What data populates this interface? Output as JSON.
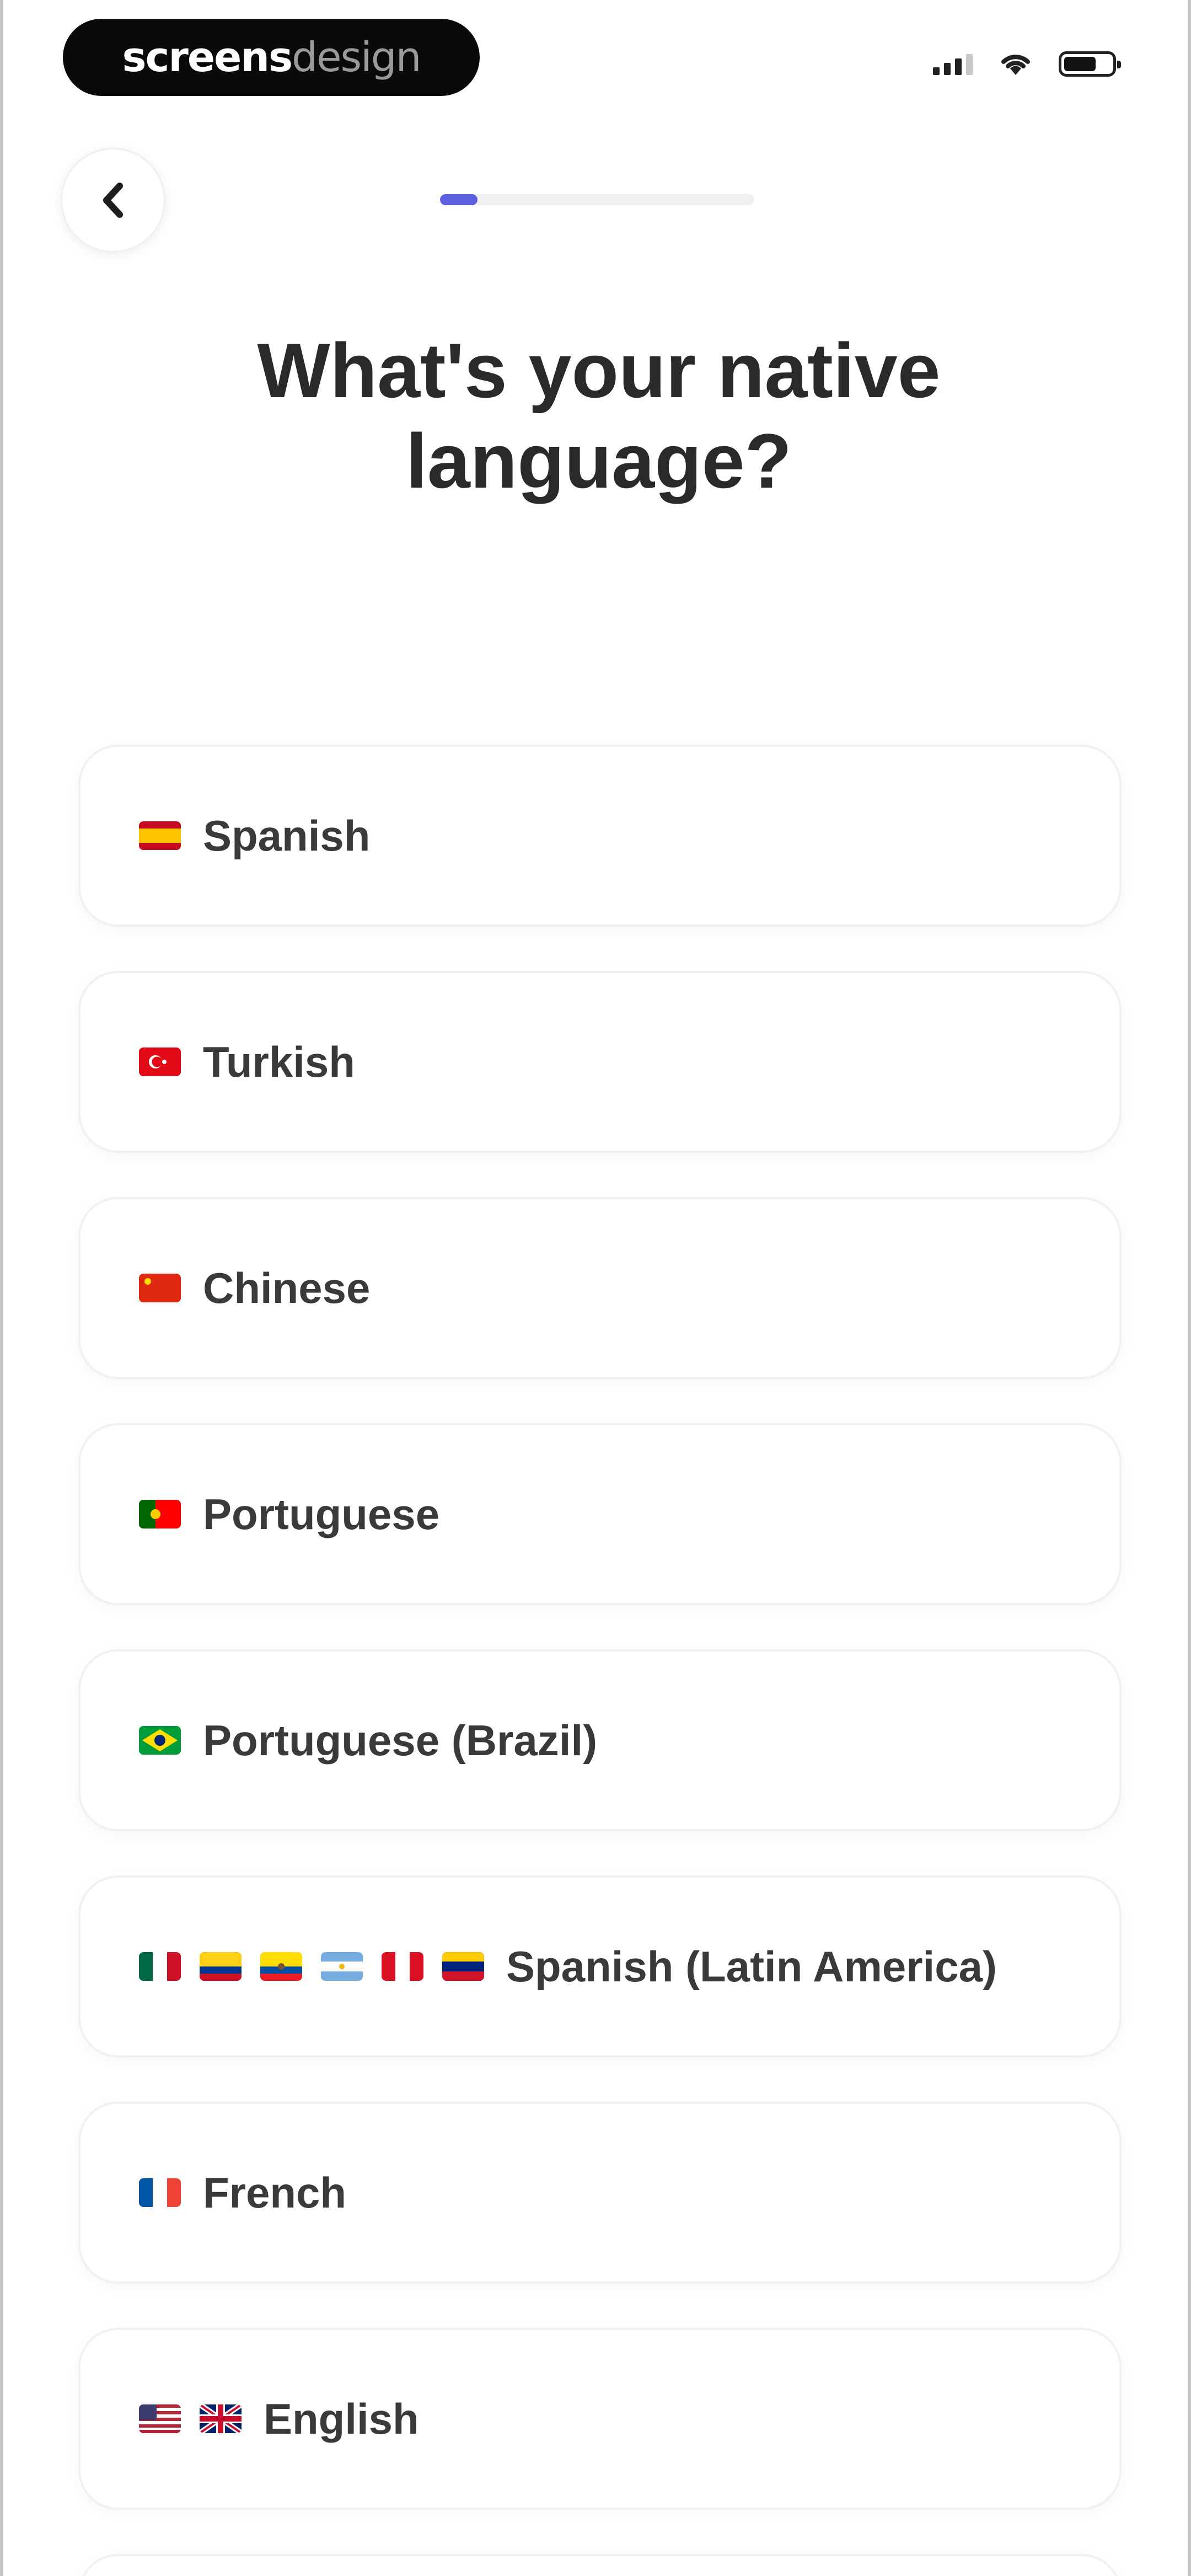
{
  "watermark": {
    "bold": "screens",
    "light": "design"
  },
  "header": {
    "progress_fraction": 0.12
  },
  "title": "What's your native language?",
  "languages": [
    {
      "label": "Spanish",
      "flags": [
        "spain-flag-icon"
      ]
    },
    {
      "label": "Turkish",
      "flags": [
        "turkey-flag-icon"
      ]
    },
    {
      "label": "Chinese",
      "flags": [
        "china-flag-icon"
      ]
    },
    {
      "label": "Portuguese",
      "flags": [
        "portugal-flag-icon"
      ]
    },
    {
      "label": "Portuguese (Brazil)",
      "flags": [
        "brazil-flag-icon"
      ]
    },
    {
      "label": "Spanish (Latin America)",
      "flags": [
        "mexico-flag-icon",
        "colombia-flag-icon",
        "ecuador-flag-icon",
        "argentina-flag-icon",
        "peru-flag-icon",
        "venezuela-flag-icon"
      ]
    },
    {
      "label": "French",
      "flags": [
        "france-flag-icon"
      ]
    },
    {
      "label": "English",
      "flags": [
        "usa-flag-icon",
        "uk-flag-icon"
      ]
    }
  ],
  "colors": {
    "accent": "#5b5fe0",
    "card_border": "#f1f1f1",
    "text": "#2a2a2a"
  }
}
